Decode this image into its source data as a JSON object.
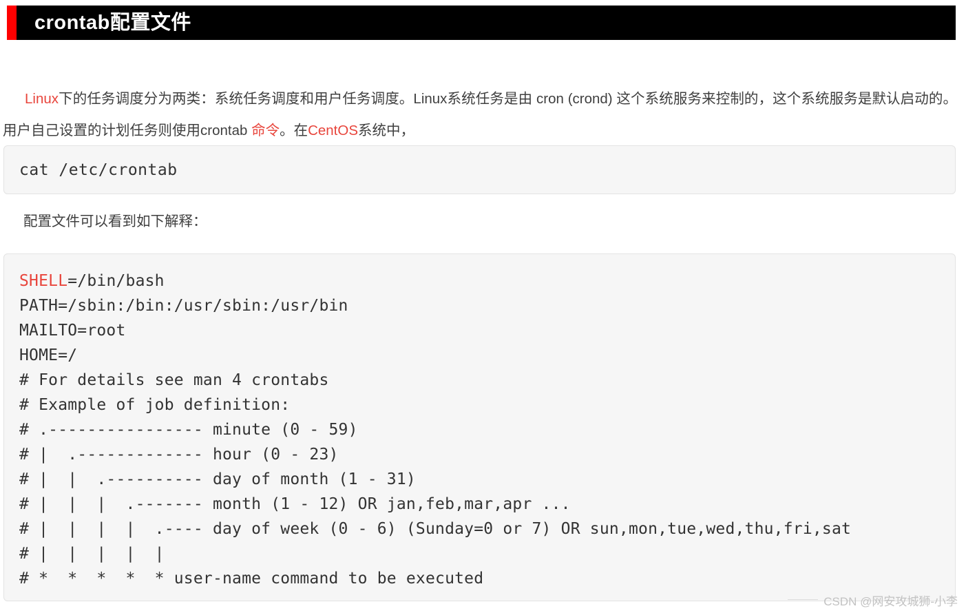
{
  "header": {
    "title": "crontab配置文件",
    "accent_color": "#ff0000",
    "background_color": "#000000",
    "text_color": "#ffffff"
  },
  "intro": {
    "segments": [
      {
        "text": "Linux",
        "highlight": true
      },
      {
        "text": "下的任务调度分为两类：系统任务调度和用户任务调度。Linux系统任务是由 cron (crond) 这个系统服务来控制的，这个系统服务是默认启动的。用户自己设置的计划任务则使用crontab ",
        "highlight": false
      },
      {
        "text": "命令",
        "highlight": true
      },
      {
        "text": "。在",
        "highlight": false
      },
      {
        "text": "CentOS",
        "highlight": true
      },
      {
        "text": "系统中，",
        "highlight": false
      }
    ],
    "highlight_color": "#e8453c",
    "text_color": "#3f3f3f"
  },
  "command_block": {
    "command": "cat /etc/crontab"
  },
  "note": {
    "text": "配置文件可以看到如下解释："
  },
  "config_block": {
    "keyword": "SHELL",
    "keyword_color": "#e8453c",
    "lines": [
      {
        "keyword": "SHELL",
        "rest": "=/bin/bash"
      },
      {
        "keyword": "",
        "rest": "PATH=/sbin:/bin:/usr/sbin:/usr/bin"
      },
      {
        "keyword": "",
        "rest": "MAILTO=root"
      },
      {
        "keyword": "",
        "rest": "HOME=/"
      },
      {
        "keyword": "",
        "rest": "# For details see man 4 crontabs"
      },
      {
        "keyword": "",
        "rest": "# Example of job definition:"
      },
      {
        "keyword": "",
        "rest": "# .---------------- minute (0 - 59)"
      },
      {
        "keyword": "",
        "rest": "# |  .------------- hour (0 - 23)"
      },
      {
        "keyword": "",
        "rest": "# |  |  .---------- day of month (1 - 31)"
      },
      {
        "keyword": "",
        "rest": "# |  |  |  .------- month (1 - 12) OR jan,feb,mar,apr ..."
      },
      {
        "keyword": "",
        "rest": "# |  |  |  |  .---- day of week (0 - 6) (Sunday=0 or 7) OR sun,mon,tue,wed,thu,fri,sat"
      },
      {
        "keyword": "",
        "rest": "# |  |  |  |  |"
      },
      {
        "keyword": "",
        "rest": "# *  *  *  *  * user-name command to be executed"
      }
    ]
  },
  "watermark": {
    "text": "CSDN @网安攻城狮-小李"
  }
}
